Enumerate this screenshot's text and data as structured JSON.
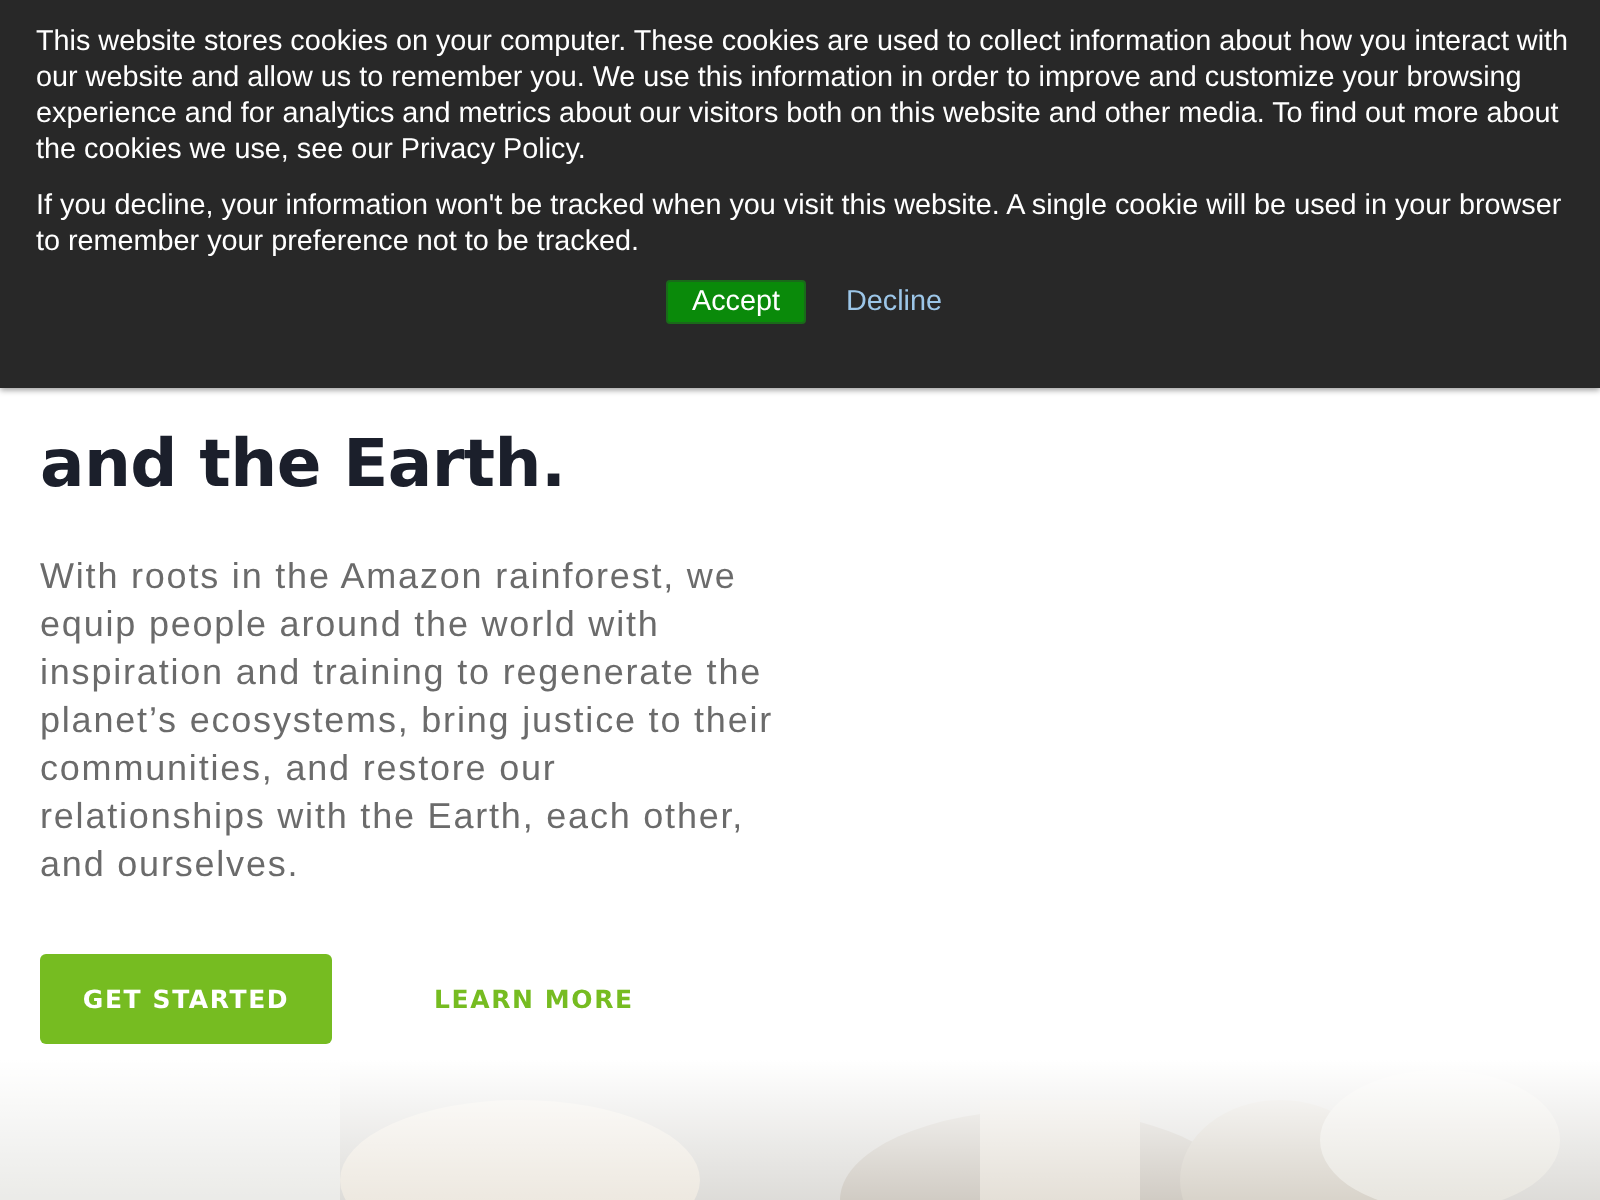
{
  "cookie_banner": {
    "paragraphs": [
      "This website stores cookies on your computer. These cookies are used to collect information about how you interact with our website and allow us to remember you. We use this information in order to improve and customize your browsing experience and for analytics and metrics about our visitors both on this website and other media. To find out more about the cookies we use, see our Privacy Policy.",
      "If you decline, your information won't be tracked when you visit this website. A single cookie will be used in your browser to remember your preference not to be tracked."
    ],
    "accept": "Accept",
    "decline": "Decline"
  },
  "hero": {
    "heading_lines": [
      "and the Earth."
    ],
    "body": "With roots in the Amazon rainforest, we equip people around the world with inspiration and training to regenerate the planet’s ecosystems, bring justice to their communities, and restore our relationships with the Earth, each other, and ourselves.",
    "primary_button": "GET STARTED",
    "secondary_link": "LEARN MORE",
    "image": {
      "kind": "picture"
    }
  }
}
